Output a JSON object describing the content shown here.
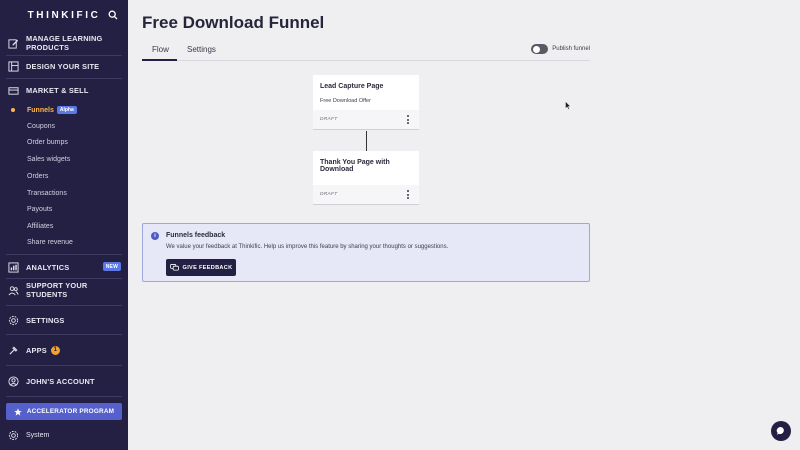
{
  "sidebar": {
    "logo": "THINKIFIC",
    "main_items": {
      "manage": "MANAGE LEARNING PRODUCTS",
      "design": "DESIGN YOUR SITE",
      "market": "MARKET & SELL",
      "analytics": "ANALYTICS",
      "support": "SUPPORT YOUR STUDENTS",
      "settings": "SETTINGS",
      "apps": "APPS",
      "account": "JOHN'S ACCOUNT"
    },
    "badges": {
      "alpha": "Alpha",
      "new": "NEW",
      "apps_count": "1"
    },
    "sub_items": {
      "funnels": "Funnels",
      "coupons": "Coupons",
      "order_bumps": "Order bumps",
      "sales_widgets": "Sales widgets",
      "orders": "Orders",
      "transactions": "Transactions",
      "payouts": "Payouts",
      "affiliates": "Affiliates",
      "share_revenue": "Share revenue"
    },
    "accelerator": "ACCELERATOR PROGRAM",
    "system": "System"
  },
  "page": {
    "title": "Free Download Funnel",
    "tabs": {
      "flow": "Flow",
      "settings": "Settings"
    },
    "publish_label": "Publish funnel"
  },
  "cards": {
    "lead": {
      "title": "Lead Capture Page",
      "subtitle": "Free Download Offer",
      "status": "DRAFT"
    },
    "thanks": {
      "title": "Thank You Page with Download",
      "status": "DRAFT"
    }
  },
  "feedback": {
    "title": "Funnels feedback",
    "text": "We value your feedback at Thinkific. Help us improve this feature by sharing your thoughts or suggestions.",
    "button": "GIVE FEEDBACK"
  },
  "colors": {
    "sidebar_bg": "#232043",
    "accent": "#5560cc",
    "active": "#ffb649"
  }
}
